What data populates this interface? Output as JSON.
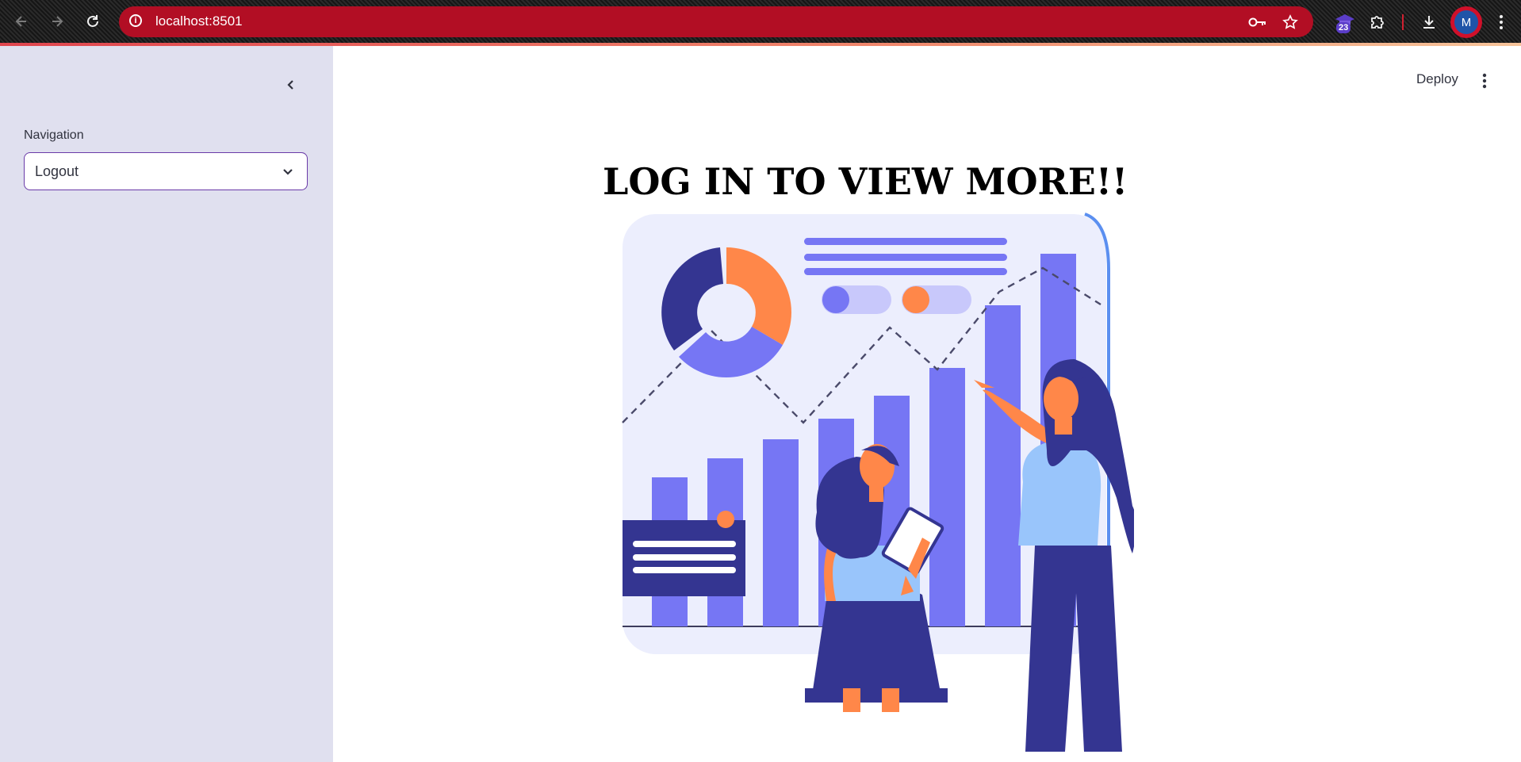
{
  "browser": {
    "url": "localhost:8501",
    "extension_badge_count": "23",
    "profile_initial": "M",
    "omnibox_color": "#b20e24"
  },
  "sidebar": {
    "nav_label": "Navigation",
    "select_value": "Logout",
    "background": "#e0e0ef"
  },
  "header": {
    "deploy_label": "Deploy"
  },
  "main": {
    "headline": "LOG IN TO VIEW MORE!!",
    "illustration_icon": "analytics-illustration"
  }
}
